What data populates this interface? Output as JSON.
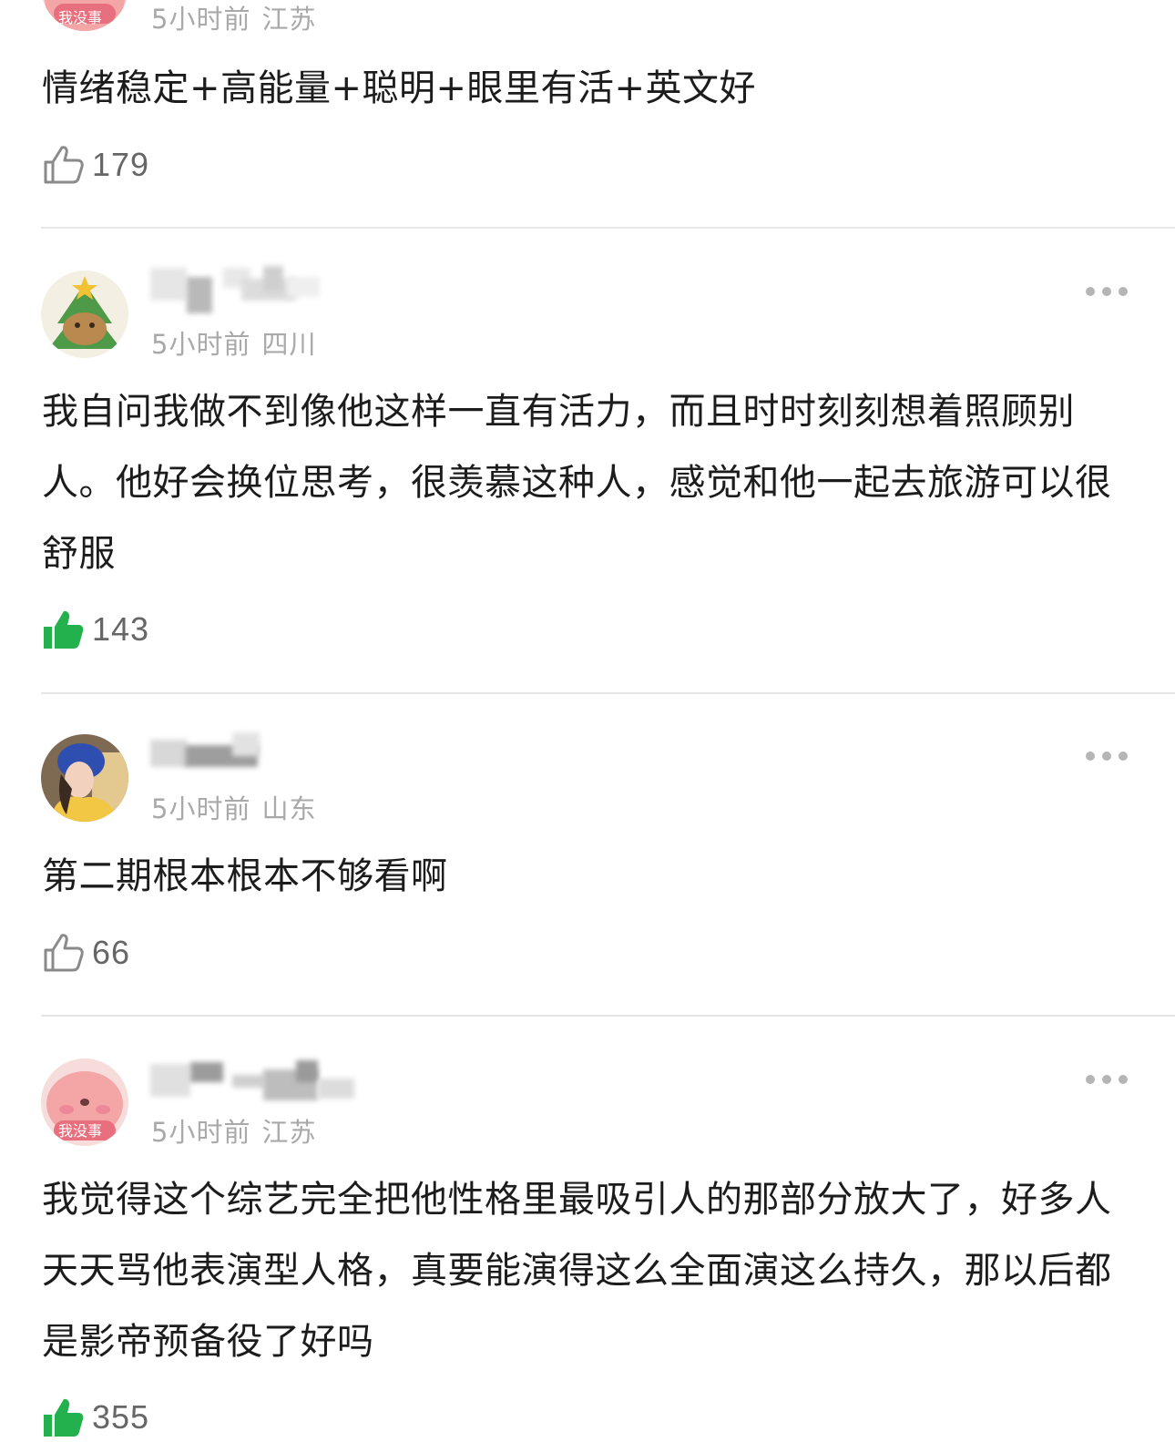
{
  "comments": [
    {
      "badge": "我没事",
      "time": "5小时前",
      "location": "江苏",
      "text": "情绪稳定+高能量+聪明+眼里有活+英文好",
      "likes": "179",
      "liked": false
    },
    {
      "time": "5小时前",
      "location": "四川",
      "text": "我自问我做不到像他这样一直有活力，而且时时刻刻想着照顾别人。他好会换位思考，很羡慕这种人，感觉和他一起去旅游可以很舒服",
      "likes": "143",
      "liked": true
    },
    {
      "time": "5小时前",
      "location": "山东",
      "text": "第二期根本根本不够看啊",
      "likes": "66",
      "liked": false
    },
    {
      "badge": "我没事",
      "time": "5小时前",
      "location": "江苏",
      "text": "我觉得这个综艺完全把他性格里最吸引人的那部分放大了，好多人天天骂他表演型人格，真要能演得这么全面演这么持久，那以后都是影帝预备役了好吗",
      "likes": "355",
      "liked": true
    }
  ],
  "colors": {
    "liked_green": "#22b14c",
    "meta_gray": "#a9a9a9",
    "icon_gray": "#8a8a8a",
    "divider": "#e6e6e6"
  },
  "icons": {
    "like_outline": "thumbs-up-outline-icon",
    "like_filled": "thumbs-up-filled-icon",
    "more": "more-dots-icon"
  }
}
